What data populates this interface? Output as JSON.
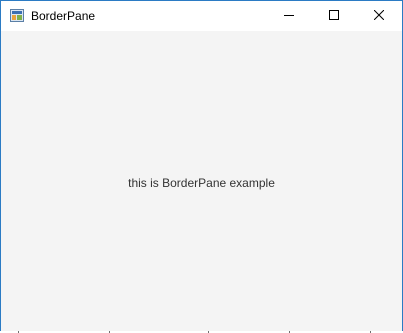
{
  "window": {
    "title": "BorderPane",
    "app_icon": "java-app-icon",
    "controls": {
      "minimize_icon": "minimize-icon",
      "maximize_icon": "maximize-icon",
      "close_icon": "close-icon"
    },
    "border_color": "#2b7bc4"
  },
  "content": {
    "background": "#f4f4f4",
    "center_text": "this is BorderPane example"
  }
}
